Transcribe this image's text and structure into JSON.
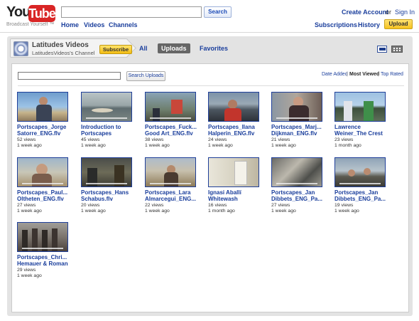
{
  "header": {
    "logo_you": "You",
    "logo_tube": "Tube",
    "tagline": "Broadcast Yourself ™",
    "search_placeholder": "",
    "search_button": "Search",
    "nav": [
      "Home",
      "Videos",
      "Channels"
    ],
    "create_account": "Create Account",
    "or": "or",
    "sign_in": "Sign In",
    "subscriptions": "Subscriptions",
    "history": "History",
    "upload": "Upload"
  },
  "channel": {
    "name": "Latitudes Videos",
    "subtitle": "LatitudesVideos's Channel",
    "subscribe": "Subscribe",
    "tabs": [
      "All",
      "Uploads",
      "Favorites"
    ],
    "selected_tab": "Uploads"
  },
  "uploads": {
    "search_value": "",
    "search_button": "Search Uploads",
    "sort": [
      "Date Added",
      "Most Viewed",
      "Top Rated"
    ],
    "sort_selected": "Most Viewed",
    "separator": "|",
    "videos": [
      {
        "title": "Portscapes_Jorge Satorre_ENG.flv",
        "views": "52 views",
        "ago": "1 week ago"
      },
      {
        "title": "Introduction to Portscapes",
        "views": "45 views",
        "ago": "1 week ago"
      },
      {
        "title": "Portscapes_Fuck... Good Art_ENG.flv",
        "views": "38 views",
        "ago": "1 week ago"
      },
      {
        "title": "Portscapes_Ilana Halperin_ENG.flv",
        "views": "24 views",
        "ago": "1 week ago"
      },
      {
        "title": "Portscapes_Marj... Dijkman_ENG.flv",
        "views": "21 views",
        "ago": "1 week ago"
      },
      {
        "title": "Lawrence Weiner_The Crest",
        "views": "23 views",
        "ago": "1 month ago"
      },
      {
        "title": "Portscapes_Paul... Oltheten_ENG.flv",
        "views": "27 views",
        "ago": "1 week ago"
      },
      {
        "title": "Portscapes_Hans Schabus.flv",
        "views": "20 views",
        "ago": "1 week ago"
      },
      {
        "title": "Portscapes_Lara Almarcegui_ENG...",
        "views": "22 views",
        "ago": "1 week ago"
      },
      {
        "title": "Ignasi Aballí Whitewash",
        "views": "16 views",
        "ago": "1 month ago"
      },
      {
        "title": "Portscapes_Jan Dibbets_ENG_Pa...",
        "views": "27 views",
        "ago": "1 week ago"
      },
      {
        "title": "Portscapes_Jan Dibbets_ENG_Pa...",
        "views": "19 views",
        "ago": "1 week ago"
      },
      {
        "title": "Portscapes_Chri... Hemauer & Roman",
        "views": "29 views",
        "ago": "1 week ago"
      }
    ]
  },
  "colors": {
    "link": "#1a3e9c",
    "youtube_red": "#d92525",
    "upload_yellow": "#f6c21f",
    "tab_selected": "#666666"
  }
}
